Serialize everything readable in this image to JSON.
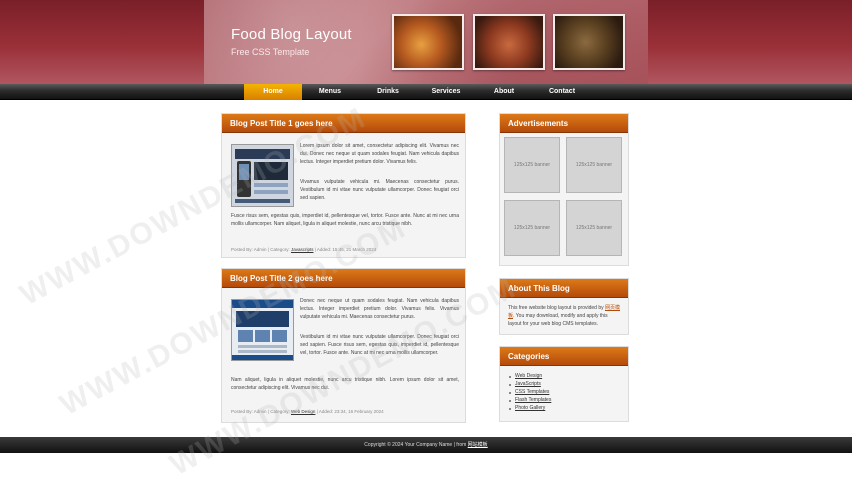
{
  "header": {
    "title": "Food Blog Layout",
    "subtitle": "Free CSS Template"
  },
  "nav": [
    "Home",
    "Menus",
    "Drinks",
    "Services",
    "About",
    "Contact"
  ],
  "posts": [
    {
      "title": "Blog Post Title 1 goes here",
      "para1": "Lorem ipsum dolor sit amet, consectetur adipiscing elit. Vivamus nec dui. Donec nec neque ut quam sodales feugiat. Nam vehicula dapibus lectus. Integer imperdiet pretium dolor. Vivamus felis.",
      "para2": "Vivamus vulputate vehicula mi. Maecenas consectetur purus. Vestibulum id mi vitae nunc vulputate ullamcorper. Donec feugiat orci sed sapien.",
      "para3": "Fusce risus sem, egestas quis, imperdiet id, pellentesque vel, tortor. Fusce ante. Nunc at mi nec urna mollis ullamcorper. Nam aliquet, ligula in aliquet molestie, nunc arcu tristique nibh.",
      "meta_prefix": "Posted By: Admin | Category:",
      "category": "Javascripts",
      "meta_suffix": "| Added: 15:45, 21 March 2024"
    },
    {
      "title": "Blog Post Title 2 goes here",
      "para1": "Donec nec neque ut quam sodales feugiat. Nam vehicula dapibus lectus. Integer imperdiet pretium dolor. Vivamus felis. Vivamus vulputate vehicula mi. Maecenas consectetur purus.",
      "para2": "Vestibulum id mi vitae nunc vulputate ullamcorper. Donec feugiat orci sed sapien. Fusce risus sem, egestas quis, imperdiet id, pellentesque vel, tortor. Fusce ante. Nunc at mi nec urna mollis ullamcorper.",
      "para3": "Nam aliquet, ligula in aliquet molestie, nunc arcu tristique nibh. Lorem ipsum dolor sit amet, consectetur adipiscing elit. Vivamus nec dui.",
      "meta_prefix": "Posted By: Admin | Category:",
      "category": "Web Design",
      "meta_suffix": "| Added: 23:34, 16 February 2024"
    }
  ],
  "sidebar": {
    "ads_title": "Advertisements",
    "banner_label": "125x125 banner",
    "about_title": "About This Blog",
    "about_text_1": "This free website blog layout is provided by",
    "about_link": "网页模板",
    "about_text_2": ". You may download, modify and apply this layout for your web blog CMS templates.",
    "categories_title": "Categories",
    "categories": [
      "Web Design",
      "JavaScripts",
      "CSS Templates",
      "Flash Templates",
      "Photo Gallery"
    ]
  },
  "footer": {
    "text": "Copyright © 2024 Your Company Name | from",
    "link": "网站模板"
  },
  "watermark": "WWW.DOWNDEMO.COM",
  "colors": {
    "header_red": "#9a3038",
    "orange_accent": "#dd7a18",
    "nav_active": "#f5b400",
    "nav_dark": "#2b2b2b"
  }
}
